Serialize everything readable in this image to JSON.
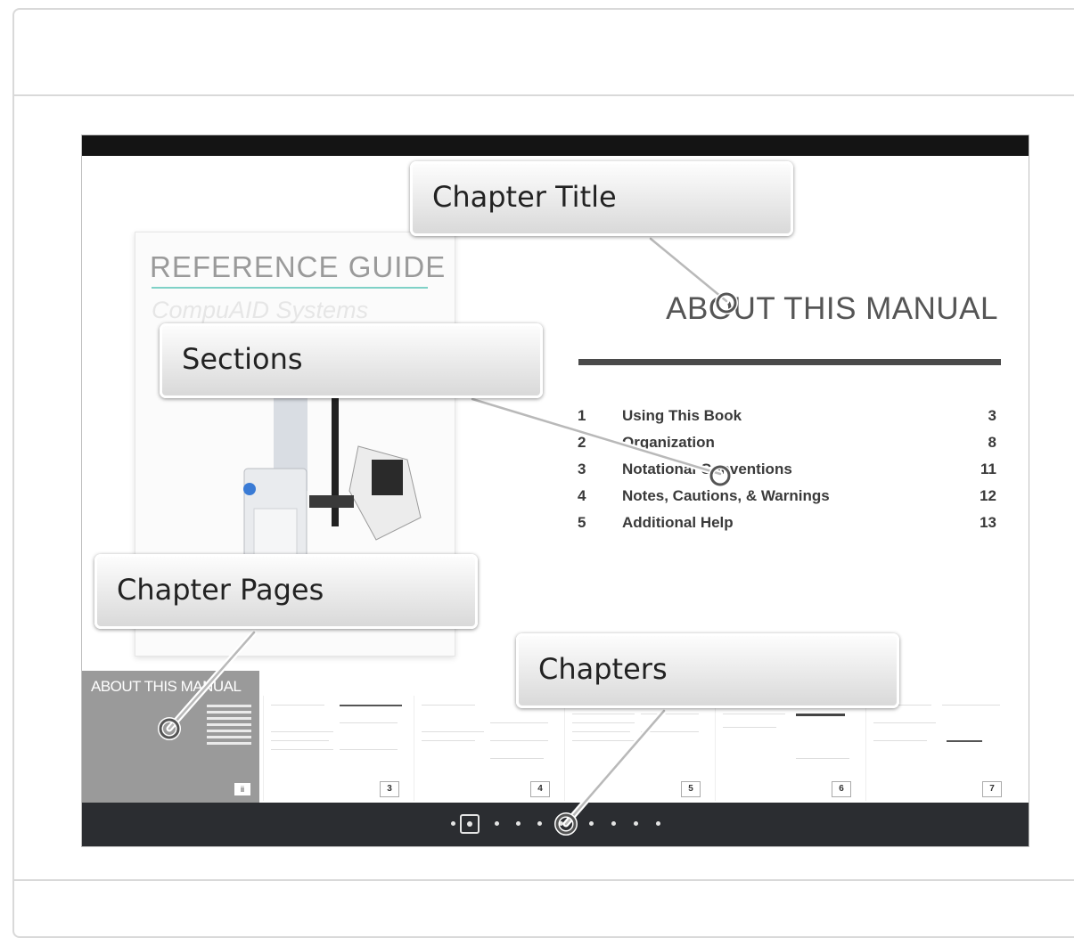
{
  "cover": {
    "title": "REFERENCE GUIDE",
    "subtitle": "CompuAID Systems"
  },
  "chapter": {
    "title": "ABOUT THIS MANUAL",
    "sections": [
      {
        "num": "1",
        "label": "Using This Book",
        "page": "3"
      },
      {
        "num": "2",
        "label": "Organization",
        "page": "8"
      },
      {
        "num": "3",
        "label": "Notational Conventions",
        "page": "11"
      },
      {
        "num": "4",
        "label": "Notes, Cautions, & Warnings",
        "page": "12"
      },
      {
        "num": "5",
        "label": "Additional Help",
        "page": "13"
      }
    ]
  },
  "thumbnails": {
    "active_title": "ABOUT THIS MANUAL",
    "active_page": "ii",
    "pages": [
      "3",
      "4",
      "5",
      "6",
      "7"
    ]
  },
  "callouts": {
    "chapter_title": "Chapter Title",
    "sections": "Sections",
    "chapter_pages": "Chapter Pages",
    "chapters": "Chapters"
  },
  "colors": {
    "topbar": "#141414",
    "navbar": "#2b2d31",
    "cover_accent": "#7fd1c7",
    "active_thumb": "#9a9a9a"
  }
}
